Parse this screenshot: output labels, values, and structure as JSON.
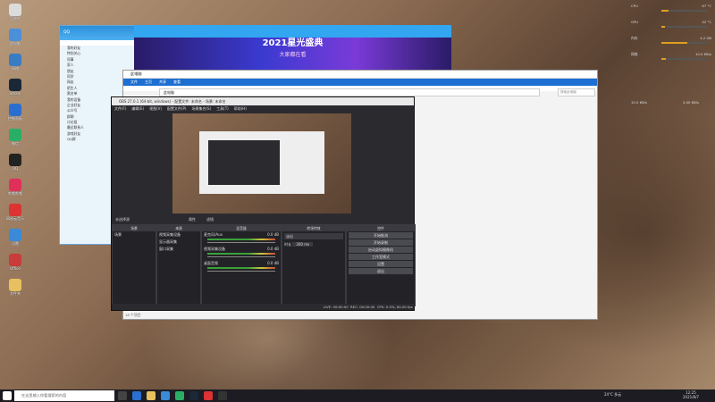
{
  "desktop": {
    "icons": [
      {
        "label": "回收站",
        "color": "#dcdcdc"
      },
      {
        "label": "此电脑",
        "color": "#4a90d9"
      },
      {
        "label": "网络",
        "color": "#3a7cc4"
      },
      {
        "label": "Steam",
        "color": "#1b2838"
      },
      {
        "label": "控制面板",
        "color": "#2a6fd0"
      },
      {
        "label": "微信",
        "color": "#2aae67"
      },
      {
        "label": "QQ",
        "color": "#222"
      },
      {
        "label": "哔哩哔哩",
        "color": "#e0305a"
      },
      {
        "label": "网易云音乐",
        "color": "#d33"
      },
      {
        "label": "迅雷",
        "color": "#3a8ad8"
      },
      {
        "label": "Office",
        "color": "#c83c3c"
      },
      {
        "label": "文件夹",
        "color": "#e8c060"
      }
    ]
  },
  "qq": {
    "title": "QQ",
    "groups": [
      "我的好友",
      "特别关心",
      "同事",
      "家人",
      "朋友",
      "同学",
      "网友",
      "陌生人",
      "黑名单",
      "我的设备",
      "企业好友",
      "公众号",
      "群聊",
      "讨论组",
      "最近联系人",
      "游戏好友",
      "QQ群"
    ]
  },
  "banner": {
    "title": "2021星光盛典",
    "subtitle": "大家都在看"
  },
  "explorer": {
    "title": "此电脑",
    "tabs": [
      "文件",
      "主页",
      "共享",
      "查看"
    ],
    "address": "此电脑",
    "search_placeholder": "搜索此电脑",
    "status": "18 个项目"
  },
  "obs": {
    "title": "OBS 27.0.1 (64-bit, windows) - 配置文件: 未命名 - 场景: 未命名",
    "menu": [
      "文件(F)",
      "编辑(E)",
      "视图(V)",
      "配置文件(P)",
      "场景集合(S)",
      "工具(T)",
      "帮助(H)"
    ],
    "no_source": "未选择源",
    "properties": "属性",
    "filters": "滤镜",
    "docks": {
      "scenes": "场景",
      "sources": "来源",
      "mixer": "混音器",
      "transitions": "转场特效",
      "controls": "控件"
    },
    "scene_items": [
      "场景"
    ],
    "source_items": [
      "视频采集设备",
      "显示器采集",
      "窗口采集"
    ],
    "mixer_items": [
      {
        "name": "麦克风/Aux",
        "level": "0.0 dB"
      },
      {
        "name": "视频采集设备",
        "level": "0.0 dB"
      },
      {
        "name": "桌面音频",
        "level": "0.0 dB"
      }
    ],
    "transition": {
      "type": "淡出",
      "duration_label": "时长",
      "duration": "300 ms"
    },
    "controls": [
      "开始推流",
      "开始录制",
      "启动虚拟摄像机",
      "工作室模式",
      "设置",
      "退出"
    ],
    "status": {
      "live": "LIVE: 00:00:00",
      "rec": "REC: 00:00:00",
      "cpu": "CPU: 0.0%, 60.00 fps"
    }
  },
  "monitor": {
    "rows": [
      {
        "label": "CPU",
        "value": "67 °C",
        "pct": 0.16
      },
      {
        "label": "GPU",
        "value": "42 °C",
        "pct": 0.07
      },
      {
        "label": "内存",
        "value": "4.2 GB",
        "pct": 0.55
      },
      {
        "label": "网络",
        "value": "10.0 KB/s",
        "pct": 0.1
      }
    ],
    "net_up": "10.0 KB/s",
    "net_down": "4.00 KB/s"
  },
  "taskbar": {
    "search_placeholder": "在这里输入你要搜索的内容",
    "weather": "24°C 多云",
    "time": "12:25",
    "date": "2021/8/7"
  },
  "colors": {
    "accent": "#2b8fd9",
    "obs_bg": "#2b2b2f",
    "meter_green": "#3aa03a"
  }
}
